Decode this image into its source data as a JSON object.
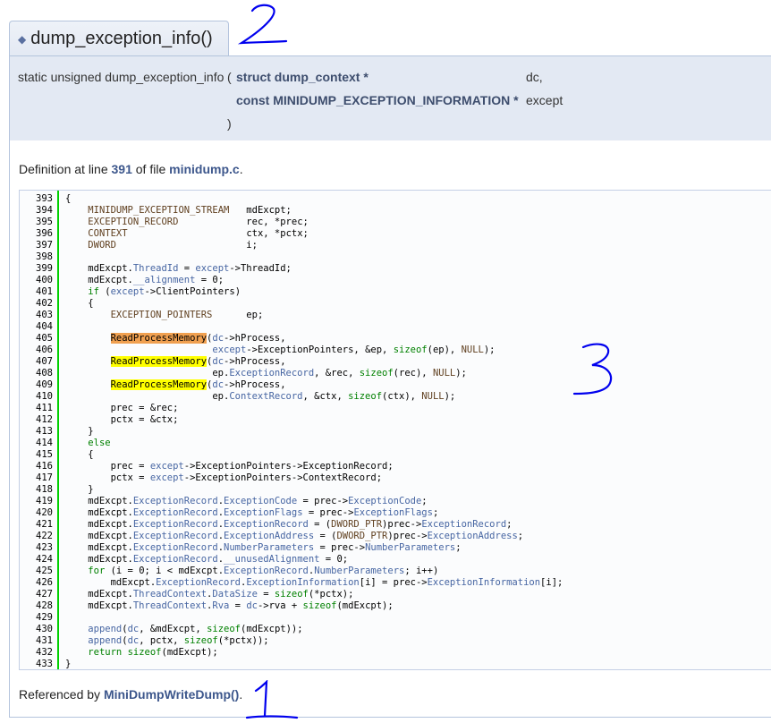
{
  "title": {
    "glyph": "◆",
    "text": "dump_exception_info()"
  },
  "proto": {
    "prefix": "static unsigned dump_exception_info",
    "paren_open": "(",
    "param1_type": "struct dump_context *",
    "param1_name": "dc,",
    "param2_type": "const MINIDUMP_EXCEPTION_INFORMATION *",
    "param2_name": "except",
    "paren_close": ")"
  },
  "definition": {
    "before": "Definition at line ",
    "line": "391",
    "middle": " of file ",
    "file": "minidump.c",
    "after": "."
  },
  "referenced": {
    "before": "Referenced by ",
    "link": "MiniDumpWriteDump()",
    "after": "."
  },
  "annotations": [
    "2",
    "3",
    "1"
  ],
  "code_lines": [
    {
      "n": "393",
      "tokens": [
        [
          "p",
          "{"
        ]
      ]
    },
    {
      "n": "394",
      "tokens": [
        [
          "p",
          "    "
        ],
        [
          "t",
          "MINIDUMP_EXCEPTION_STREAM"
        ],
        [
          "p",
          "   mdExcpt;"
        ]
      ]
    },
    {
      "n": "395",
      "tokens": [
        [
          "p",
          "    "
        ],
        [
          "t",
          "EXCEPTION_RECORD"
        ],
        [
          "p",
          "            rec, *prec;"
        ]
      ]
    },
    {
      "n": "396",
      "tokens": [
        [
          "p",
          "    "
        ],
        [
          "t",
          "CONTEXT"
        ],
        [
          "p",
          "                     ctx, *pctx;"
        ]
      ]
    },
    {
      "n": "397",
      "tokens": [
        [
          "p",
          "    "
        ],
        [
          "t",
          "DWORD"
        ],
        [
          "p",
          "                       i;"
        ]
      ]
    },
    {
      "n": "398",
      "tokens": []
    },
    {
      "n": "399",
      "tokens": [
        [
          "p",
          "    mdExcpt."
        ],
        [
          "f",
          "ThreadId"
        ],
        [
          "p",
          " = "
        ],
        [
          "f",
          "except"
        ],
        [
          "p",
          "->ThreadId;"
        ]
      ]
    },
    {
      "n": "400",
      "tokens": [
        [
          "p",
          "    mdExcpt."
        ],
        [
          "f",
          "__alignment"
        ],
        [
          "p",
          " = 0;"
        ]
      ]
    },
    {
      "n": "401",
      "tokens": [
        [
          "p",
          "    "
        ],
        [
          "k",
          "if"
        ],
        [
          "p",
          " ("
        ],
        [
          "f",
          "except"
        ],
        [
          "p",
          "->ClientPointers)"
        ]
      ]
    },
    {
      "n": "402",
      "tokens": [
        [
          "p",
          "    {"
        ]
      ]
    },
    {
      "n": "403",
      "tokens": [
        [
          "p",
          "        "
        ],
        [
          "t",
          "EXCEPTION_POINTERS"
        ],
        [
          "p",
          "      ep;"
        ]
      ]
    },
    {
      "n": "404",
      "tokens": []
    },
    {
      "n": "405",
      "tokens": [
        [
          "p",
          "        "
        ],
        [
          "or",
          "ReadProcessMemory"
        ],
        [
          "p",
          "("
        ],
        [
          "f",
          "dc"
        ],
        [
          "p",
          "->hProcess,"
        ]
      ]
    },
    {
      "n": "406",
      "tokens": [
        [
          "p",
          "                          "
        ],
        [
          "f",
          "except"
        ],
        [
          "p",
          "->ExceptionPointers, &ep, "
        ],
        [
          "k",
          "sizeof"
        ],
        [
          "p",
          "(ep), "
        ],
        [
          "t",
          "NULL"
        ],
        [
          "p",
          ");"
        ]
      ]
    },
    {
      "n": "407",
      "tokens": [
        [
          "p",
          "        "
        ],
        [
          "ye",
          "ReadProcessMemory"
        ],
        [
          "p",
          "("
        ],
        [
          "f",
          "dc"
        ],
        [
          "p",
          "->hProcess,"
        ]
      ]
    },
    {
      "n": "408",
      "tokens": [
        [
          "p",
          "                          ep."
        ],
        [
          "f",
          "ExceptionRecord"
        ],
        [
          "p",
          ", &rec, "
        ],
        [
          "k",
          "sizeof"
        ],
        [
          "p",
          "(rec), "
        ],
        [
          "t",
          "NULL"
        ],
        [
          "p",
          ");"
        ]
      ]
    },
    {
      "n": "409",
      "tokens": [
        [
          "p",
          "        "
        ],
        [
          "ye",
          "ReadProcessMemory"
        ],
        [
          "p",
          "("
        ],
        [
          "f",
          "dc"
        ],
        [
          "p",
          "->hProcess,"
        ]
      ]
    },
    {
      "n": "410",
      "tokens": [
        [
          "p",
          "                          ep."
        ],
        [
          "f",
          "ContextRecord"
        ],
        [
          "p",
          ", &ctx, "
        ],
        [
          "k",
          "sizeof"
        ],
        [
          "p",
          "(ctx), "
        ],
        [
          "t",
          "NULL"
        ],
        [
          "p",
          ");"
        ]
      ]
    },
    {
      "n": "411",
      "tokens": [
        [
          "p",
          "        prec = &rec;"
        ]
      ]
    },
    {
      "n": "412",
      "tokens": [
        [
          "p",
          "        pctx = &ctx;"
        ]
      ]
    },
    {
      "n": "413",
      "tokens": [
        [
          "p",
          "    }"
        ]
      ]
    },
    {
      "n": "414",
      "tokens": [
        [
          "p",
          "    "
        ],
        [
          "k",
          "else"
        ]
      ]
    },
    {
      "n": "415",
      "tokens": [
        [
          "p",
          "    {"
        ]
      ]
    },
    {
      "n": "416",
      "tokens": [
        [
          "p",
          "        prec = "
        ],
        [
          "f",
          "except"
        ],
        [
          "p",
          "->ExceptionPointers->ExceptionRecord;"
        ]
      ]
    },
    {
      "n": "417",
      "tokens": [
        [
          "p",
          "        pctx = "
        ],
        [
          "f",
          "except"
        ],
        [
          "p",
          "->ExceptionPointers->ContextRecord;"
        ]
      ]
    },
    {
      "n": "418",
      "tokens": [
        [
          "p",
          "    }"
        ]
      ]
    },
    {
      "n": "419",
      "tokens": [
        [
          "p",
          "    mdExcpt."
        ],
        [
          "f",
          "ExceptionRecord"
        ],
        [
          "p",
          "."
        ],
        [
          "f",
          "ExceptionCode"
        ],
        [
          "p",
          " = prec->"
        ],
        [
          "f",
          "ExceptionCode"
        ],
        [
          "p",
          ";"
        ]
      ]
    },
    {
      "n": "420",
      "tokens": [
        [
          "p",
          "    mdExcpt."
        ],
        [
          "f",
          "ExceptionRecord"
        ],
        [
          "p",
          "."
        ],
        [
          "f",
          "ExceptionFlags"
        ],
        [
          "p",
          " = prec->"
        ],
        [
          "f",
          "ExceptionFlags"
        ],
        [
          "p",
          ";"
        ]
      ]
    },
    {
      "n": "421",
      "tokens": [
        [
          "p",
          "    mdExcpt."
        ],
        [
          "f",
          "ExceptionRecord"
        ],
        [
          "p",
          "."
        ],
        [
          "f",
          "ExceptionRecord"
        ],
        [
          "p",
          " = ("
        ],
        [
          "t",
          "DWORD_PTR"
        ],
        [
          "p",
          ")prec->"
        ],
        [
          "f",
          "ExceptionRecord"
        ],
        [
          "p",
          ";"
        ]
      ]
    },
    {
      "n": "422",
      "tokens": [
        [
          "p",
          "    mdExcpt."
        ],
        [
          "f",
          "ExceptionRecord"
        ],
        [
          "p",
          "."
        ],
        [
          "f",
          "ExceptionAddress"
        ],
        [
          "p",
          " = ("
        ],
        [
          "t",
          "DWORD_PTR"
        ],
        [
          "p",
          ")prec->"
        ],
        [
          "f",
          "ExceptionAddress"
        ],
        [
          "p",
          ";"
        ]
      ]
    },
    {
      "n": "423",
      "tokens": [
        [
          "p",
          "    mdExcpt."
        ],
        [
          "f",
          "ExceptionRecord"
        ],
        [
          "p",
          "."
        ],
        [
          "f",
          "NumberParameters"
        ],
        [
          "p",
          " = prec->"
        ],
        [
          "f",
          "NumberParameters"
        ],
        [
          "p",
          ";"
        ]
      ]
    },
    {
      "n": "424",
      "tokens": [
        [
          "p",
          "    mdExcpt."
        ],
        [
          "f",
          "ExceptionRecord"
        ],
        [
          "p",
          "."
        ],
        [
          "f",
          "__unusedAlignment"
        ],
        [
          "p",
          " = 0;"
        ]
      ]
    },
    {
      "n": "425",
      "tokens": [
        [
          "p",
          "    "
        ],
        [
          "k",
          "for"
        ],
        [
          "p",
          " (i = 0; i < mdExcpt."
        ],
        [
          "f",
          "ExceptionRecord"
        ],
        [
          "p",
          "."
        ],
        [
          "f",
          "NumberParameters"
        ],
        [
          "p",
          "; i++)"
        ]
      ]
    },
    {
      "n": "426",
      "tokens": [
        [
          "p",
          "        mdExcpt."
        ],
        [
          "f",
          "ExceptionRecord"
        ],
        [
          "p",
          "."
        ],
        [
          "f",
          "ExceptionInformation"
        ],
        [
          "p",
          "[i] = prec->"
        ],
        [
          "f",
          "ExceptionInformation"
        ],
        [
          "p",
          "[i];"
        ]
      ]
    },
    {
      "n": "427",
      "tokens": [
        [
          "p",
          "    mdExcpt."
        ],
        [
          "f",
          "ThreadContext"
        ],
        [
          "p",
          "."
        ],
        [
          "f",
          "DataSize"
        ],
        [
          "p",
          " = "
        ],
        [
          "k",
          "sizeof"
        ],
        [
          "p",
          "(*pctx);"
        ]
      ]
    },
    {
      "n": "428",
      "tokens": [
        [
          "p",
          "    mdExcpt."
        ],
        [
          "f",
          "ThreadContext"
        ],
        [
          "p",
          "."
        ],
        [
          "f",
          "Rva"
        ],
        [
          "p",
          " = "
        ],
        [
          "f",
          "dc"
        ],
        [
          "p",
          "->rva + "
        ],
        [
          "k",
          "sizeof"
        ],
        [
          "p",
          "(mdExcpt);"
        ]
      ]
    },
    {
      "n": "429",
      "tokens": []
    },
    {
      "n": "430",
      "tokens": [
        [
          "p",
          "    "
        ],
        [
          "f",
          "append"
        ],
        [
          "p",
          "("
        ],
        [
          "f",
          "dc"
        ],
        [
          "p",
          ", &mdExcpt, "
        ],
        [
          "k",
          "sizeof"
        ],
        [
          "p",
          "(mdExcpt));"
        ]
      ]
    },
    {
      "n": "431",
      "tokens": [
        [
          "p",
          "    "
        ],
        [
          "f",
          "append"
        ],
        [
          "p",
          "("
        ],
        [
          "f",
          "dc"
        ],
        [
          "p",
          ", pctx, "
        ],
        [
          "k",
          "sizeof"
        ],
        [
          "p",
          "(*pctx));"
        ]
      ]
    },
    {
      "n": "432",
      "tokens": [
        [
          "p",
          "    "
        ],
        [
          "k",
          "return"
        ],
        [
          "p",
          " "
        ],
        [
          "k",
          "sizeof"
        ],
        [
          "p",
          "(mdExcpt);"
        ]
      ]
    },
    {
      "n": "433",
      "tokens": [
        [
          "p",
          "}"
        ]
      ]
    }
  ]
}
